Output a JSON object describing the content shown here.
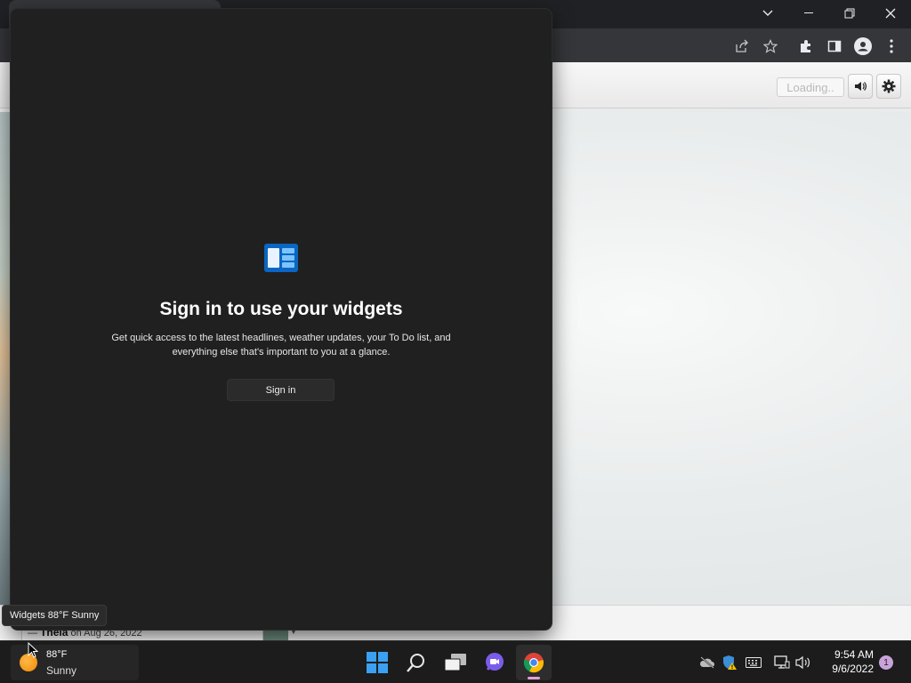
{
  "browser": {
    "window_controls": {
      "tab_search": "chevron-down",
      "minimize": "minimize",
      "restore": "restore",
      "close": "close"
    },
    "toolbar_icons": [
      "share-icon",
      "bookmark-star-icon",
      "extensions-icon",
      "side-panel-icon",
      "profile-icon",
      "menu-icon"
    ],
    "page": {
      "loading_label": "Loading..",
      "comment_author": "Thela",
      "comment_date": "on Aug 26, 2022"
    }
  },
  "widgets_panel": {
    "title": "Sign in to use your widgets",
    "description": "Get quick access to the latest headlines, weather updates, your To Do list, and everything else that's important to you at a glance.",
    "signin_label": "Sign in"
  },
  "tooltip": {
    "text": "Widgets 88°F Sunny"
  },
  "taskbar": {
    "weather": {
      "temperature": "88°F",
      "condition": "Sunny"
    },
    "apps": [
      "start",
      "search",
      "task-view",
      "teams-chat",
      "chrome"
    ],
    "active_app": "chrome",
    "tray_icons": [
      "onedrive-offline",
      "security-warning",
      "keyboard",
      "network",
      "volume"
    ],
    "clock": {
      "time": "9:54 AM",
      "date": "9/6/2022"
    },
    "notification_count": "1"
  },
  "colors": {
    "widgets_bg": "#202020",
    "taskbar_bg": "#1c1c1c",
    "browser_frame": "#202124",
    "accent_blue": "#0078d4",
    "chrome_indicator": "#e6a1d8"
  }
}
